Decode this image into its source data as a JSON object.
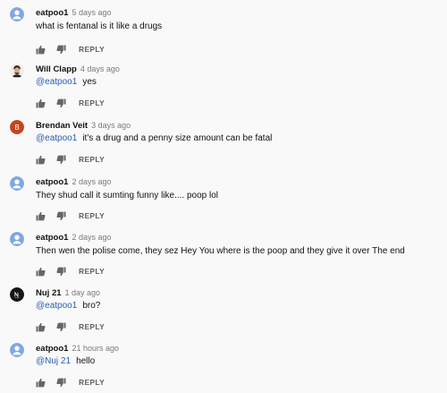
{
  "comments": [
    {
      "author": "eatpoo1",
      "time": "5 days ago",
      "mention": "",
      "text": "what is fentanal is it like a drugs",
      "reply_label": "REPLY",
      "avatar": "default-user-icon"
    },
    {
      "author": "Will Clapp",
      "time": "4 days ago",
      "mention": "@eatpoo1",
      "text": "yes",
      "reply_label": "REPLY",
      "avatar": "profile-photo"
    },
    {
      "author": "Brendan Veit",
      "time": "3 days ago",
      "mention": "@eatpoo1",
      "text": "it's a drug and a penny size amount can be fatal",
      "reply_label": "REPLY",
      "avatar": "letter-avatar",
      "avatar_letter": "B",
      "avatar_color": "#c1461f"
    },
    {
      "author": "eatpoo1",
      "time": "2 days ago",
      "mention": "",
      "text": "They shud call it sumting funny like.... poop lol",
      "reply_label": "REPLY",
      "avatar": "default-user-icon"
    },
    {
      "author": "eatpoo1",
      "time": "2 days ago",
      "mention": "",
      "text": "Then wen the polise come, they sez Hey You where is the poop and they give it over The end",
      "reply_label": "REPLY",
      "avatar": "default-user-icon"
    },
    {
      "author": "Nuj 21",
      "time": "1 day ago",
      "mention": "@eatpoo1",
      "text": "bro?",
      "reply_label": "REPLY",
      "avatar": "logo-avatar"
    },
    {
      "author": "eatpoo1",
      "time": "21 hours ago",
      "mention": "@Nuj 21",
      "text": "hello",
      "reply_label": "REPLY",
      "avatar": "default-user-icon"
    }
  ],
  "colors": {
    "mention": "#2a5db0",
    "default_avatar": "#7fa8e3",
    "meta": "#7a7a7a"
  }
}
